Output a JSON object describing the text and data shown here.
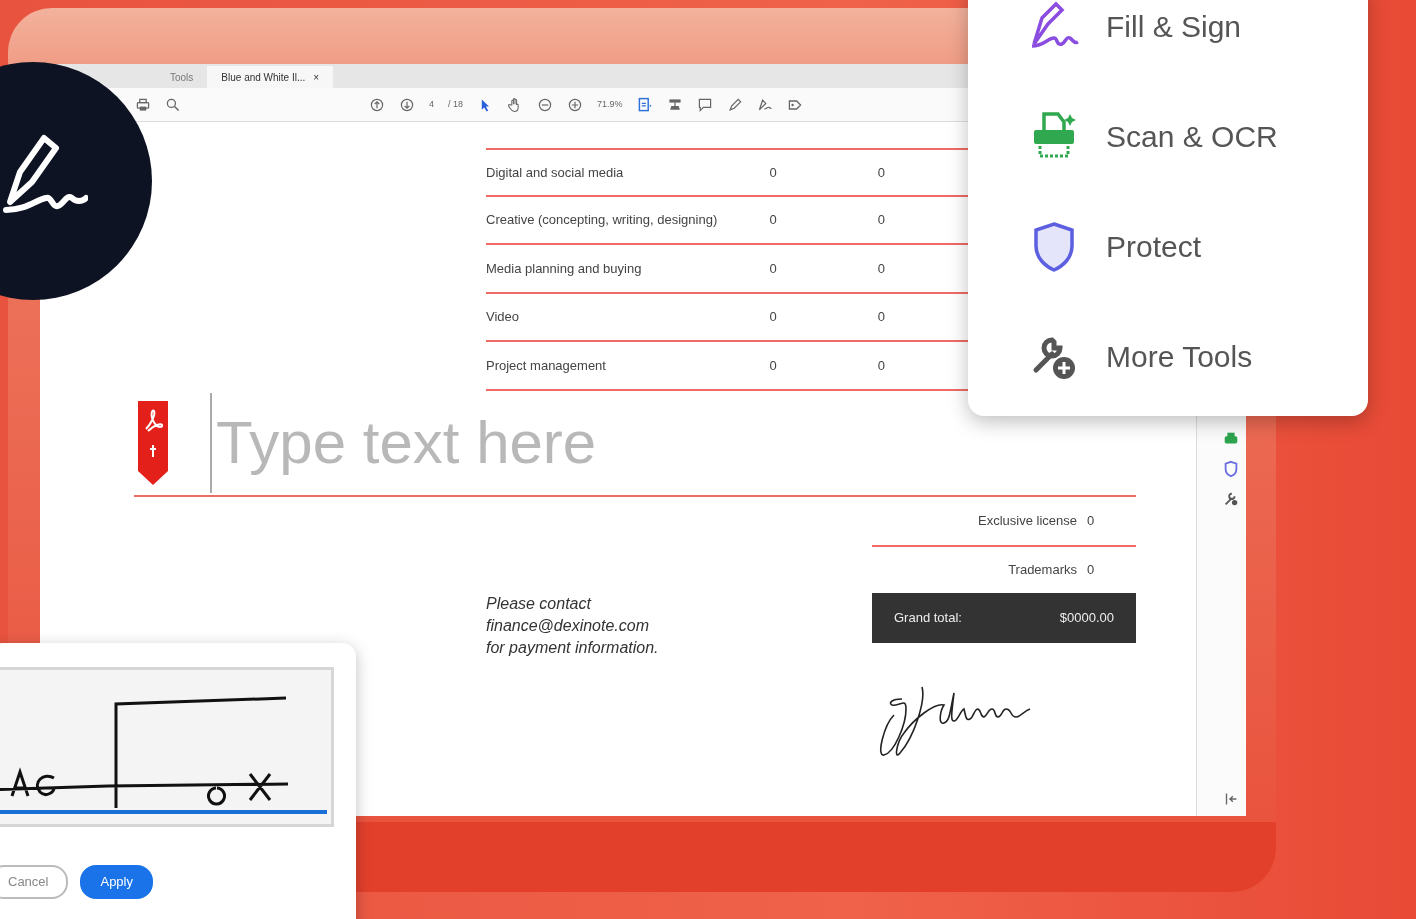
{
  "app": {
    "tabs": [
      {
        "label": "Tools",
        "selected": false
      },
      {
        "label": "Blue and White Il...",
        "selected": true,
        "close": "×"
      }
    ],
    "toolbar": {
      "page": "4",
      "page_total": "/ 18",
      "zoom": "71.9%"
    },
    "document": {
      "rows": [
        {
          "label": "Digital and social media",
          "column_2": "0",
          "column_3": "0"
        },
        {
          "label": "Creative (concepting, writing, designing)",
          "column_2": "0",
          "column_3": "0"
        },
        {
          "label": "Media planning and buying",
          "column_2": "0",
          "column_3": "0"
        },
        {
          "label": "Video",
          "column_2": "0",
          "column_3": "0"
        },
        {
          "label": "Project management",
          "column_2": "0",
          "column_3": "0"
        }
      ],
      "text_field": {
        "placeholder": "Type text here"
      },
      "contact": [
        "Please contact",
        "finance@dexinote.com",
        "for payment information."
      ],
      "totals": [
        {
          "label": "Exclusive license",
          "value": "0"
        },
        {
          "label": "Trademarks",
          "value": "0"
        }
      ],
      "grand_total": {
        "label": "Grand total:",
        "value": "$0000.00"
      }
    }
  },
  "tools_menu": {
    "items": [
      {
        "label": "Fill & Sign",
        "kind": "sign"
      },
      {
        "label": "Scan & OCR",
        "kind": "scan"
      },
      {
        "label": "Protect",
        "kind": "protect"
      },
      {
        "label": "More Tools",
        "kind": "more"
      }
    ]
  },
  "signature_dialog": {
    "buttons": [
      {
        "label": "Cancel",
        "kind": "secondary"
      },
      {
        "label": "Apply",
        "kind": "primary"
      }
    ]
  }
}
